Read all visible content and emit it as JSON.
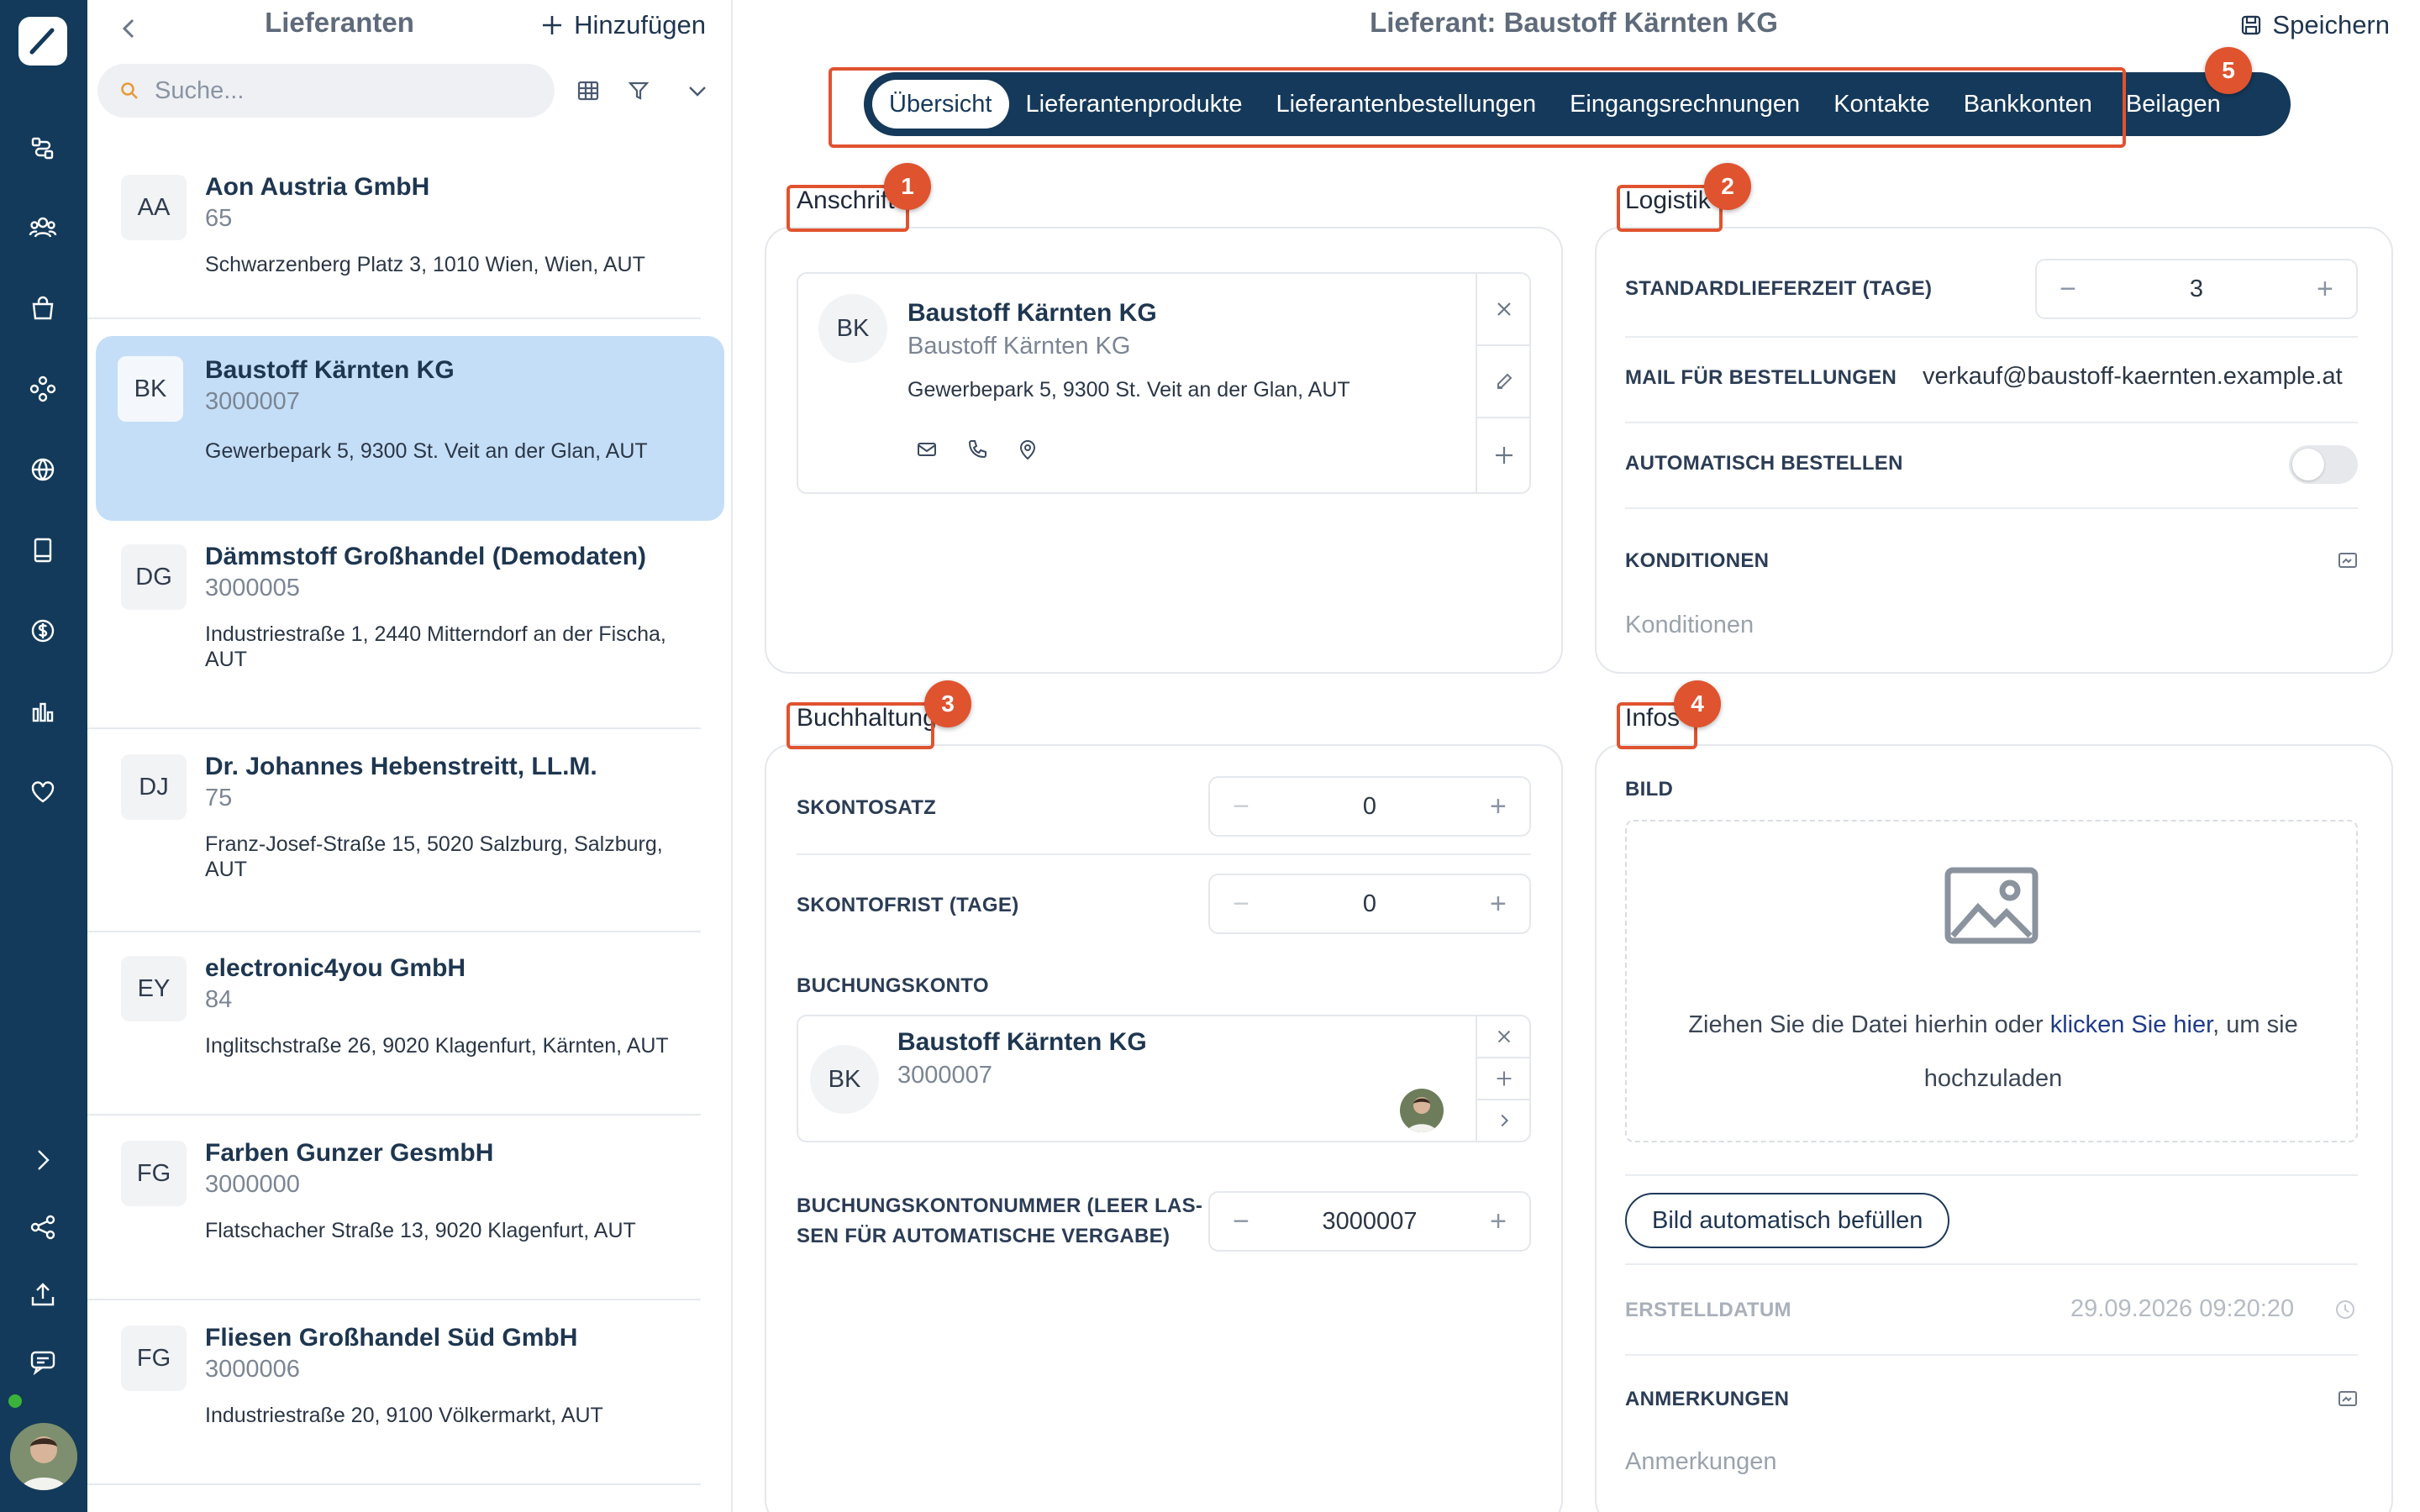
{
  "list": {
    "title": "Lieferanten",
    "add_label": "Hinzufügen",
    "search_placeholder": "Suche...",
    "items": [
      {
        "initials": "AA",
        "name": "Aon Austria GmbH",
        "number": "65",
        "address": "Schwarzenberg Platz 3, 1010 Wien, Wien, AUT",
        "selected": false
      },
      {
        "initials": "BK",
        "name": "Baustoff Kärnten KG",
        "number": "3000007",
        "address": "Gewerbepark 5, 9300 St. Veit an der Glan, AUT",
        "selected": true
      },
      {
        "initials": "DG",
        "name": "Dämmstoff Großhandel (Demodaten)",
        "number": "3000005",
        "address": "Industriestraße 1, 2440 Mitterndorf an der Fischa, AUT",
        "selected": false
      },
      {
        "initials": "DJ",
        "name": "Dr. Johannes Hebenstreitt, LL.M.",
        "number": "75",
        "address": "Franz-Josef-Straße 15, 5020 Salzburg, Salzburg, AUT",
        "selected": false
      },
      {
        "initials": "EY",
        "name": "electronic4you GmbH",
        "number": "84",
        "address": "Inglitschstraße 26, 9020 Klagenfurt, Kärnten, AUT",
        "selected": false
      },
      {
        "initials": "FG",
        "name": "Farben Gunzer GesmbH",
        "number": "3000000",
        "address": "Flatschacher Straße 13, 9020 Klagenfurt, AUT",
        "selected": false
      },
      {
        "initials": "FG",
        "name": "Fliesen Großhandel Süd GmbH",
        "number": "3000006",
        "address": "Industriestraße 20, 9100 Völkermarkt, AUT",
        "selected": false
      }
    ]
  },
  "header": {
    "title": "Lieferant: Baustoff Kärnten KG",
    "save_label": "Speichern"
  },
  "tabs": [
    "Übersicht",
    "Lieferantenprodukte",
    "Lieferantenbestellungen",
    "Eingangsrechnungen",
    "Kontakte",
    "Bankkonten",
    "Beilagen"
  ],
  "badges": [
    "1",
    "2",
    "3",
    "4",
    "5"
  ],
  "anschrift": {
    "title": "Anschrift",
    "initials": "BK",
    "name": "Baustoff Kärnten KG",
    "subname": "Baustoff Kärnten KG",
    "address": "Gewerbepark 5, 9300 St. Veit an der Glan, AUT"
  },
  "logistik": {
    "title": "Logistik",
    "lieferzeit_label": "STANDARDLIEFERZEIT (TAGE)",
    "lieferzeit_value": "3",
    "mail_label": "MAIL FÜR BESTELLUNGEN",
    "mail_value": "verkauf@baustoff-kaernten.example.at",
    "auto_label": "AUTOMATISCH BESTELLEN",
    "auto_on": false,
    "konditionen_label": "KONDITIONEN",
    "konditionen_placeholder": "Konditionen"
  },
  "buchhaltung": {
    "title": "Buchhaltung",
    "skontosatz_label": "SKONTOSATZ",
    "skontosatz_value": "0",
    "skontofrist_label": "SKONTOFRIST (TAGE)",
    "skontofrist_value": "0",
    "buchungskonto_label": "BUCHUNGSKONTO",
    "konto_initials": "BK",
    "konto_name": "Baustoff Kärnten KG",
    "konto_number": "3000007",
    "kontonummer_label_1": "BUCHUNGSKONTONUMMER (LEER LAS-",
    "kontonummer_label_2": "SEN FÜR AUTOMATISCHE VERGABE)",
    "kontonummer_value": "3000007"
  },
  "infos": {
    "title": "Infos",
    "bild_label": "BILD",
    "drop_text_1": "Ziehen Sie die Datei hierhin oder",
    "drop_link": "klicken Sie hier",
    "drop_text_2": ", um sie",
    "drop_text_3": "hochzuladen",
    "auto_fill_label": "Bild automatisch befüllen",
    "erstelldatum_label": "ERSTELLDATUM",
    "erstelldatum_value": "29.09.2026 09:20:20",
    "anmerkungen_label": "ANMERKUNGEN",
    "anmerkungen_placeholder": "Anmerkungen"
  },
  "colors": {
    "rail": "#133a5a",
    "accent": "#e0532f",
    "selected": "#c4def7",
    "tabs": "#15395a"
  }
}
